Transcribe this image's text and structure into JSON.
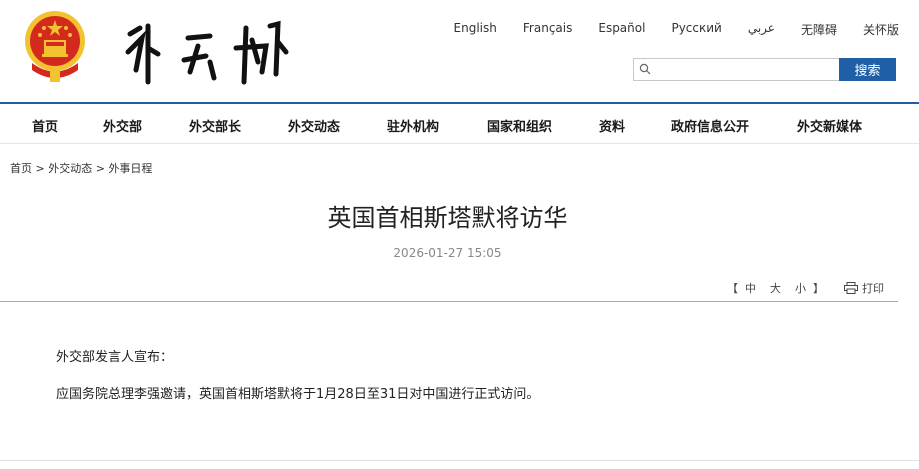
{
  "header": {
    "languages": [
      "English",
      "Français",
      "Español",
      "Русский",
      "عربي",
      "无障碍",
      "关怀版"
    ],
    "search": {
      "placeholder": "",
      "button_label": "搜索"
    }
  },
  "nav": {
    "items": [
      "首页",
      "外交部",
      "外交部长",
      "外交动态",
      "驻外机构",
      "国家和组织",
      "资料",
      "政府信息公开",
      "外交新媒体"
    ]
  },
  "breadcrumb": {
    "items": [
      "首页",
      "外交动态",
      "外事日程"
    ],
    "separator": ">"
  },
  "article": {
    "title": "英国首相斯塔默将访华",
    "date": "2026-01-27 15:05",
    "font_size": {
      "open": "【",
      "large": "中",
      "medium": "大",
      "small": "小",
      "close": "】"
    },
    "print_label": "打印",
    "paragraphs": [
      "外交部发言人宣布：",
      "应国务院总理李强邀请，英国首相斯塔默将于1月28日至31日对中国进行正式访问。"
    ]
  },
  "colors": {
    "accent": "#1e5fa8",
    "emblem_red": "#d42a1e",
    "emblem_gold": "#f2c230"
  }
}
